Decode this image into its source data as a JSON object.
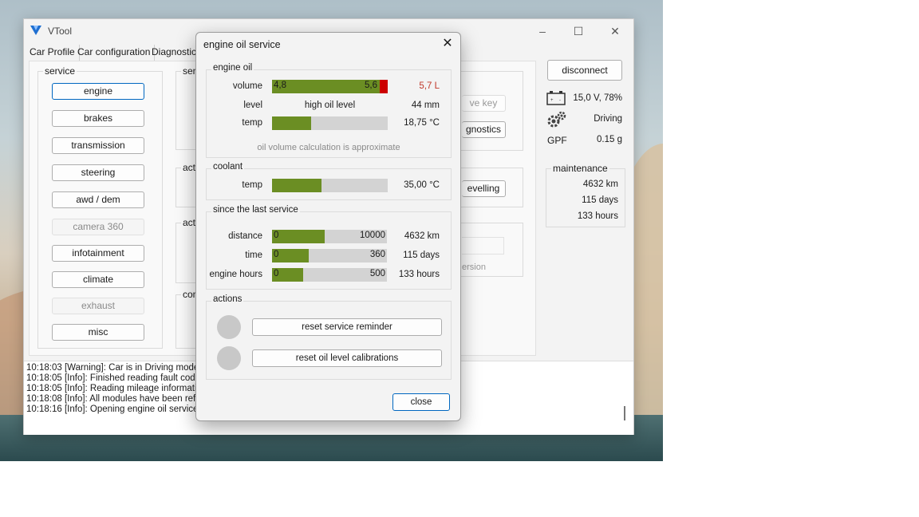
{
  "app": {
    "title": "VTool"
  },
  "menu": [
    "Car Profile",
    "Car configuration",
    "Diagnostics"
  ],
  "service": {
    "label": "service",
    "buttons": [
      {
        "label": "engine",
        "state": "active"
      },
      {
        "label": "brakes",
        "state": "normal"
      },
      {
        "label": "transmission",
        "state": "normal"
      },
      {
        "label": "steering",
        "state": "normal"
      },
      {
        "label": "awd / dem",
        "state": "normal"
      },
      {
        "label": "camera 360",
        "state": "disabled"
      },
      {
        "label": "infotainment",
        "state": "normal"
      },
      {
        "label": "climate",
        "state": "normal"
      },
      {
        "label": "exhaust",
        "state": "disabled"
      },
      {
        "label": "misc",
        "state": "normal"
      }
    ]
  },
  "hidden_groups": {
    "g1": "sen",
    "g2": "acti",
    "g3": "acti",
    "g4": "com"
  },
  "behind": {
    "key_btn": "ve key",
    "diag_btn": "gnostics",
    "level_btn": "evelling",
    "version": "ersion"
  },
  "side": {
    "disconnect": "disconnect",
    "battery": "15,0 V, 78%",
    "mode": "Driving",
    "gpf_label": "GPF",
    "gpf_value": "0.15 g",
    "maintenance_label": "maintenance",
    "maintenance": [
      "4632 km",
      "115 days",
      "133 hours"
    ]
  },
  "log": [
    "10:18:03 [Warning]: Car is in Driving mode",
    "10:18:05 [Info]: Finished reading fault codes f",
    "10:18:05 [Info]: Reading mileage information",
    "10:18:08 [Info]: All modules have been refresh",
    "10:18:16 [Info]: Opening engine oil service wi"
  ],
  "dialog": {
    "title": "engine oil service",
    "close_label": "close",
    "engine_oil": {
      "label": "engine oil",
      "volume_label": "volume",
      "volume_min": "4,8",
      "volume_max": "5,6",
      "volume_value": "5,7 L",
      "volume_fill": 0.93,
      "volume_color": "#cc0000",
      "level_label": "level",
      "level_text": "high oil level",
      "level_value": "44 mm",
      "temp_label": "temp",
      "temp_value": "18,75 °C",
      "temp_fill": 0.34,
      "note": "oil volume calculation is approximate"
    },
    "coolant": {
      "label": "coolant",
      "temp_label": "temp",
      "temp_value": "35,00 °C",
      "temp_fill": 0.43
    },
    "since": {
      "label": "since the last service",
      "rows": [
        {
          "label": "distance",
          "min": "0",
          "max": "10000",
          "value": "4632 km",
          "fill": 0.46
        },
        {
          "label": "time",
          "min": "0",
          "max": "360",
          "value": "115 days",
          "fill": 0.32
        },
        {
          "label": "engine hours",
          "min": "0",
          "max": "500",
          "value": "133 hours",
          "fill": 0.27
        }
      ]
    },
    "actions": {
      "label": "actions",
      "reset_service": "reset service reminder",
      "reset_oil": "reset oil level calibrations"
    }
  }
}
